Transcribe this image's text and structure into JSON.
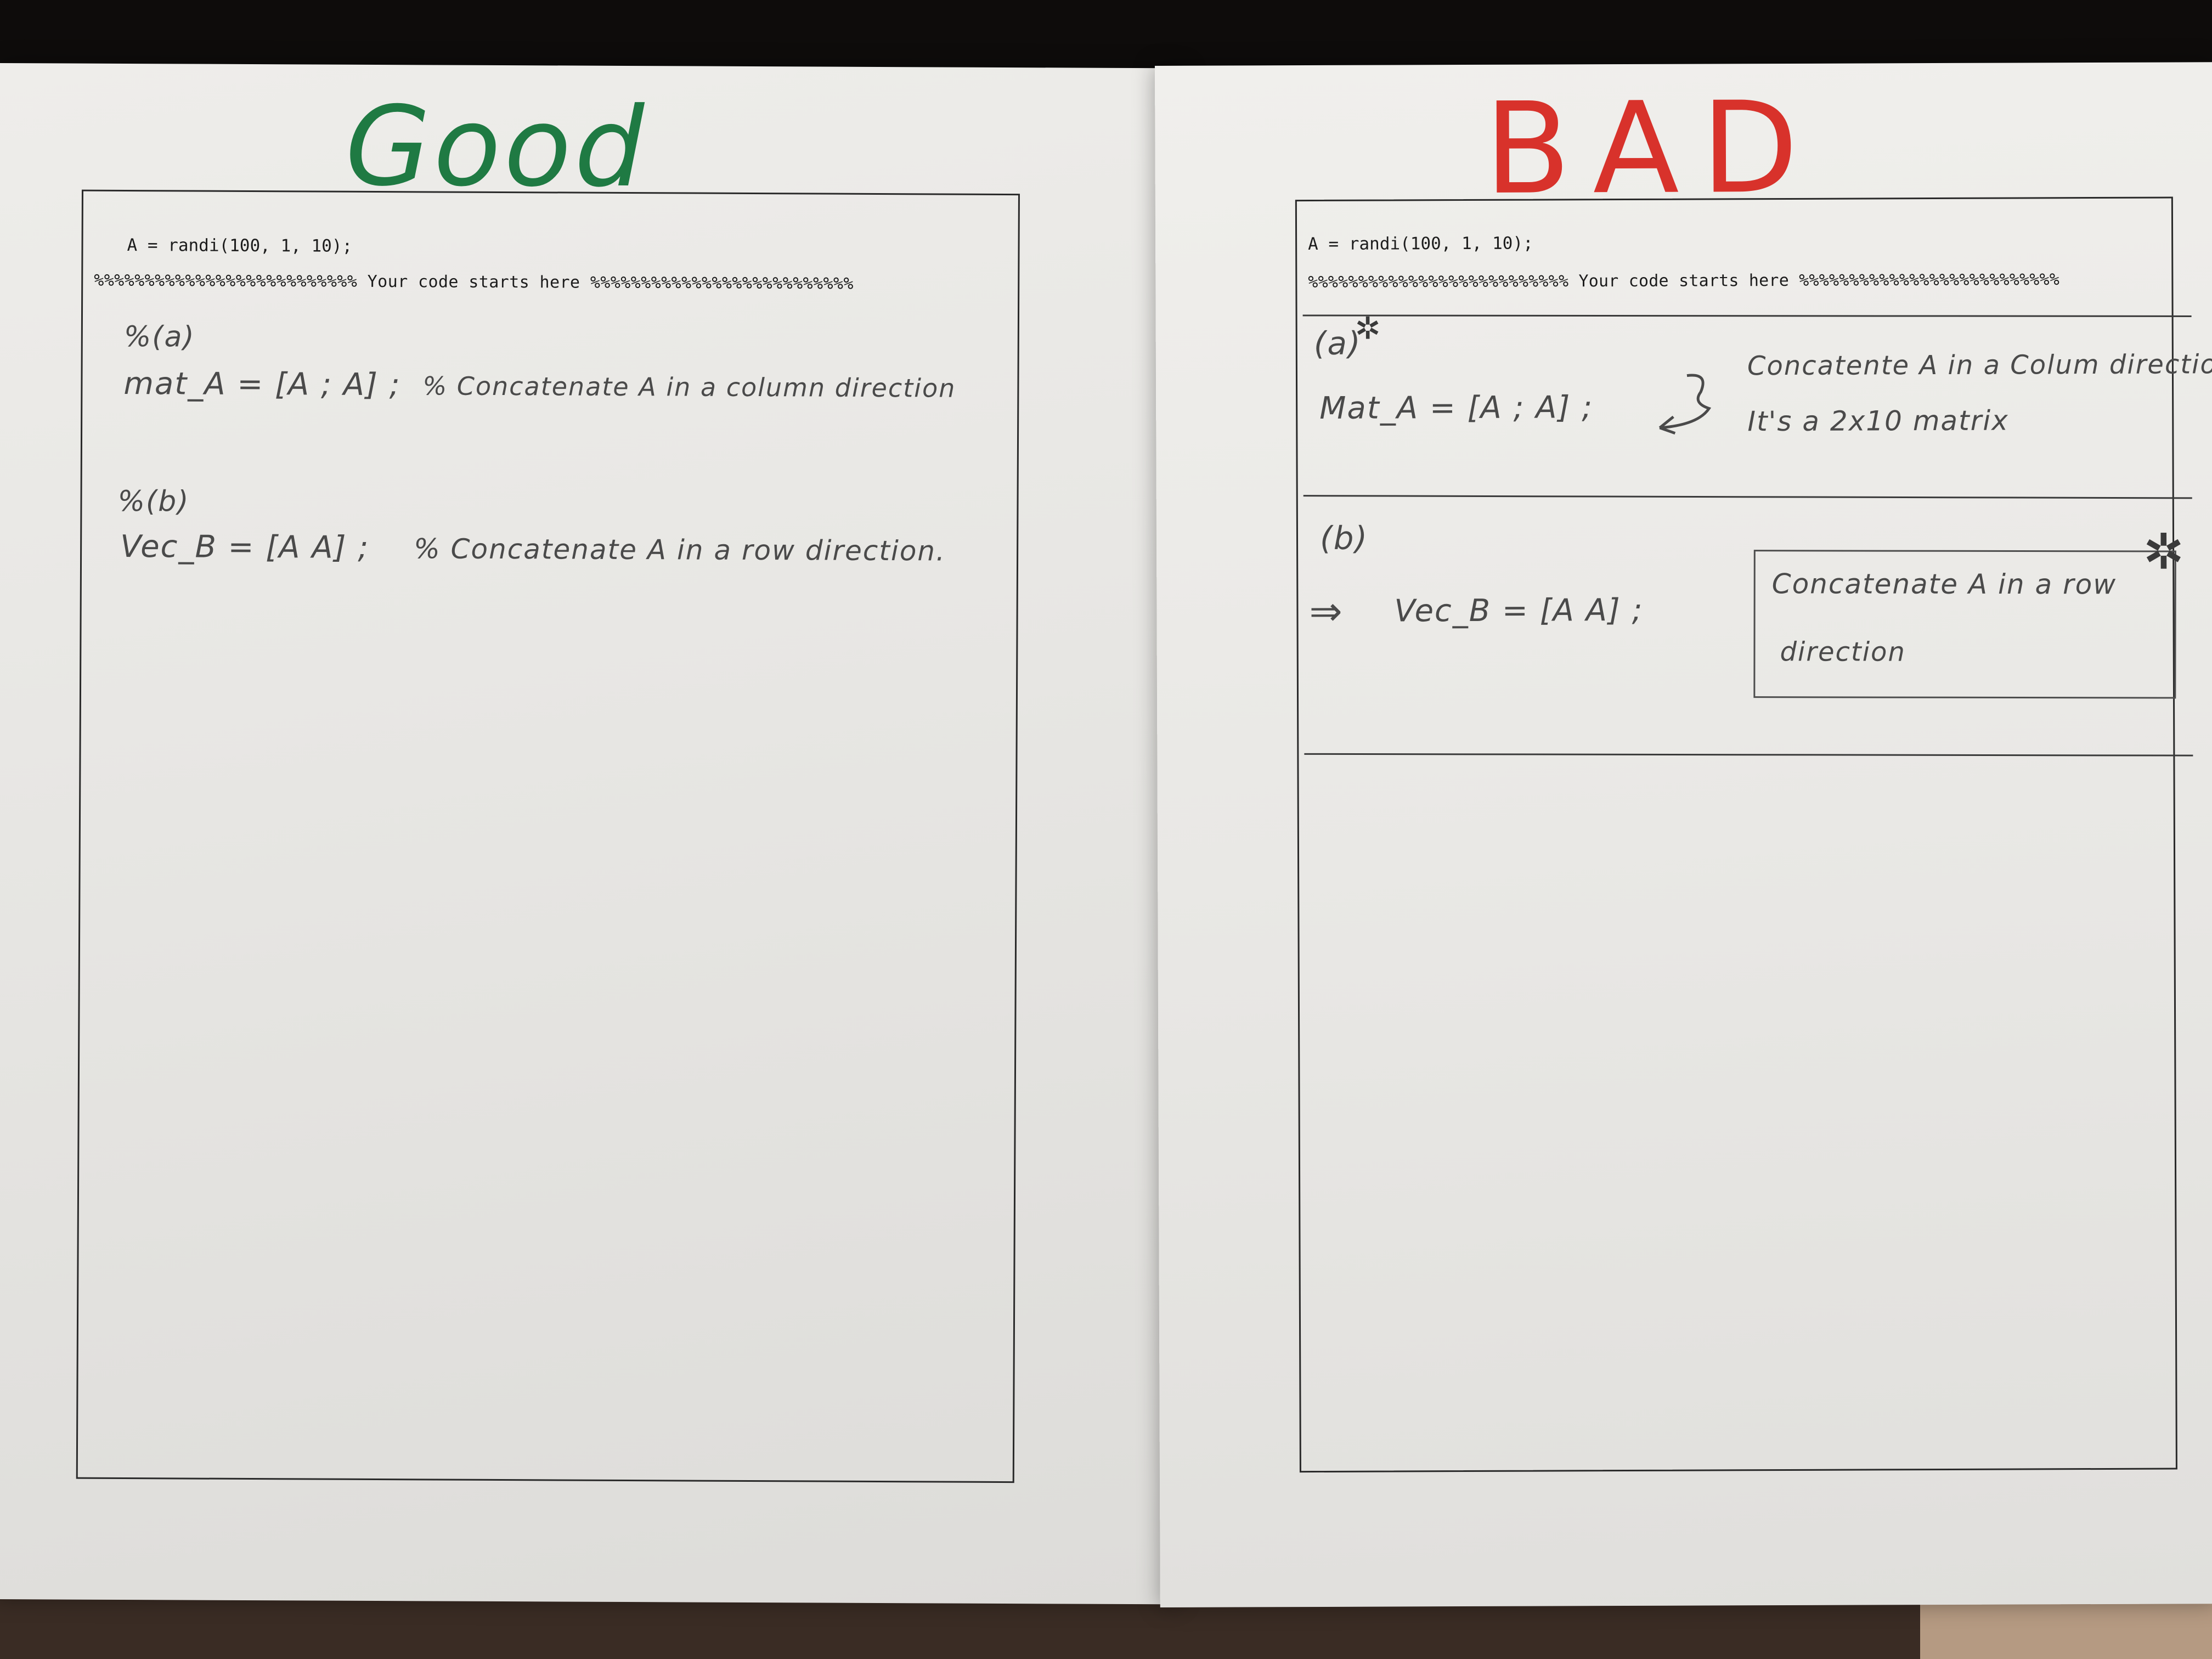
{
  "left_sheet": {
    "heading": "Good",
    "heading_color": "#1f7a43",
    "code_line": "A = randi(100, 1, 10);",
    "banner": "%%%%%%%%%%%%%%%%%%%%%%%%%% Your code starts here %%%%%%%%%%%%%%%%%%%%%%%%%%",
    "part_a_label": "%(a)",
    "part_a_code": "mat_A = [A ; A] ;",
    "part_a_comment": "% Concatenate A in a column direction",
    "part_b_label": "%(b)",
    "part_b_code": "Vec_B = [A A] ;",
    "part_b_comment": "% Concatenate A in a row direction."
  },
  "right_sheet": {
    "heading": "BAD",
    "heading_color": "#d8322b",
    "code_line": "A = randi(100, 1, 10);",
    "banner": "%%%%%%%%%%%%%%%%%%%%%%%%%% Your code starts here %%%%%%%%%%%%%%%%%%%%%%%%%%",
    "part_a_label": "(a)",
    "part_a_code": "Mat_A = [A ; A] ;",
    "part_a_note_line1": "Concatente A in a Colum direction",
    "part_a_note_line2": "It's a 2x10 matrix",
    "part_b_label": "(b)",
    "part_b_arrow": "⇒",
    "part_b_code": "Vec_B = [A A] ;",
    "part_b_note_line1": "Concatenate A in a row",
    "part_b_note_line2": "direction"
  },
  "icons": {
    "star_icon": "star-doodle-icon",
    "curly_arrow_icon": "curly-arrow-icon"
  }
}
